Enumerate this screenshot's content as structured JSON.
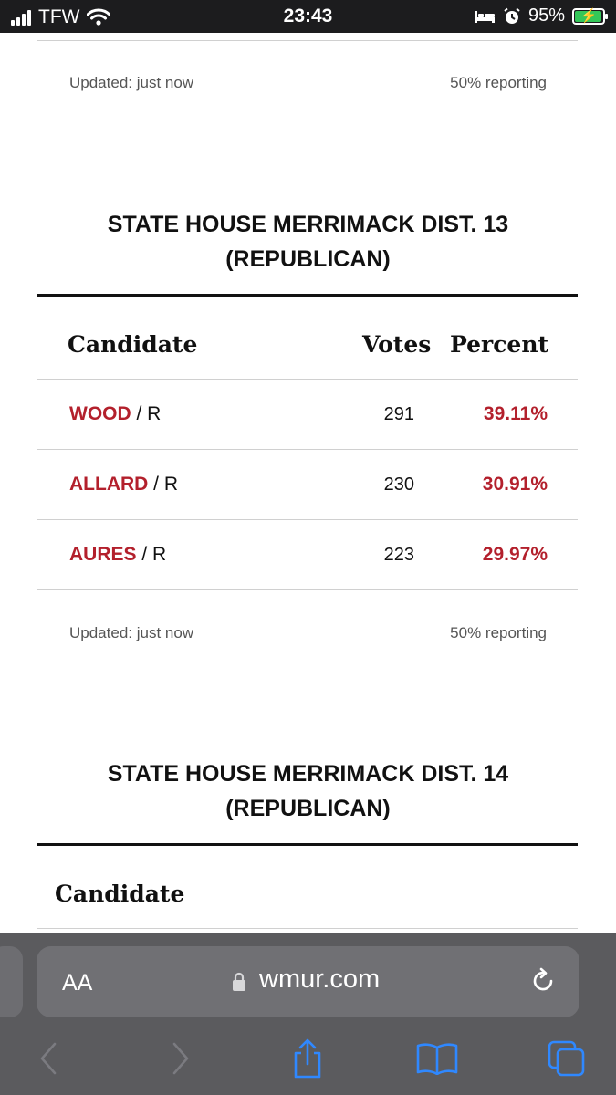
{
  "status_bar": {
    "carrier": "TFW",
    "time": "23:43",
    "battery": "95%",
    "battery_level": 0.95
  },
  "prev_race": {
    "updated": "Updated: just now",
    "reporting": "50% reporting"
  },
  "race_13": {
    "title_line1": "STATE HOUSE MERRIMACK DIST. 13",
    "title_line2": "(REPUBLICAN)",
    "col_candidate": "Candidate",
    "col_votes": "Votes",
    "col_percent": "Percent",
    "rows": [
      {
        "name": "WOOD",
        "party": " / R",
        "votes": "291",
        "percent": "39.11%"
      },
      {
        "name": "ALLARD",
        "party": " / R",
        "votes": "230",
        "percent": "30.91%"
      },
      {
        "name": "AURES",
        "party": " / R",
        "votes": "223",
        "percent": "29.97%"
      }
    ],
    "updated": "Updated: just now",
    "reporting": "50% reporting"
  },
  "race_14": {
    "title_line1": "STATE HOUSE MERRIMACK DIST. 14",
    "title_line2": "(REPUBLICAN)",
    "col_candidate": "Candidate"
  },
  "browser": {
    "text_size_label": "AA",
    "url": "wmur.com",
    "icons": [
      "signal-icon",
      "wifi-icon",
      "bed-icon",
      "alarm-icon",
      "battery-icon",
      "lock-icon",
      "reload-icon",
      "back-icon",
      "forward-icon",
      "share-icon",
      "bookmarks-icon",
      "tabs-icon"
    ]
  },
  "colors": {
    "accent": "#b3202c",
    "status_bar": "#1c1c1e",
    "toolbar": "#5b5b5e",
    "toolbar_icon": "#2f88ff"
  }
}
